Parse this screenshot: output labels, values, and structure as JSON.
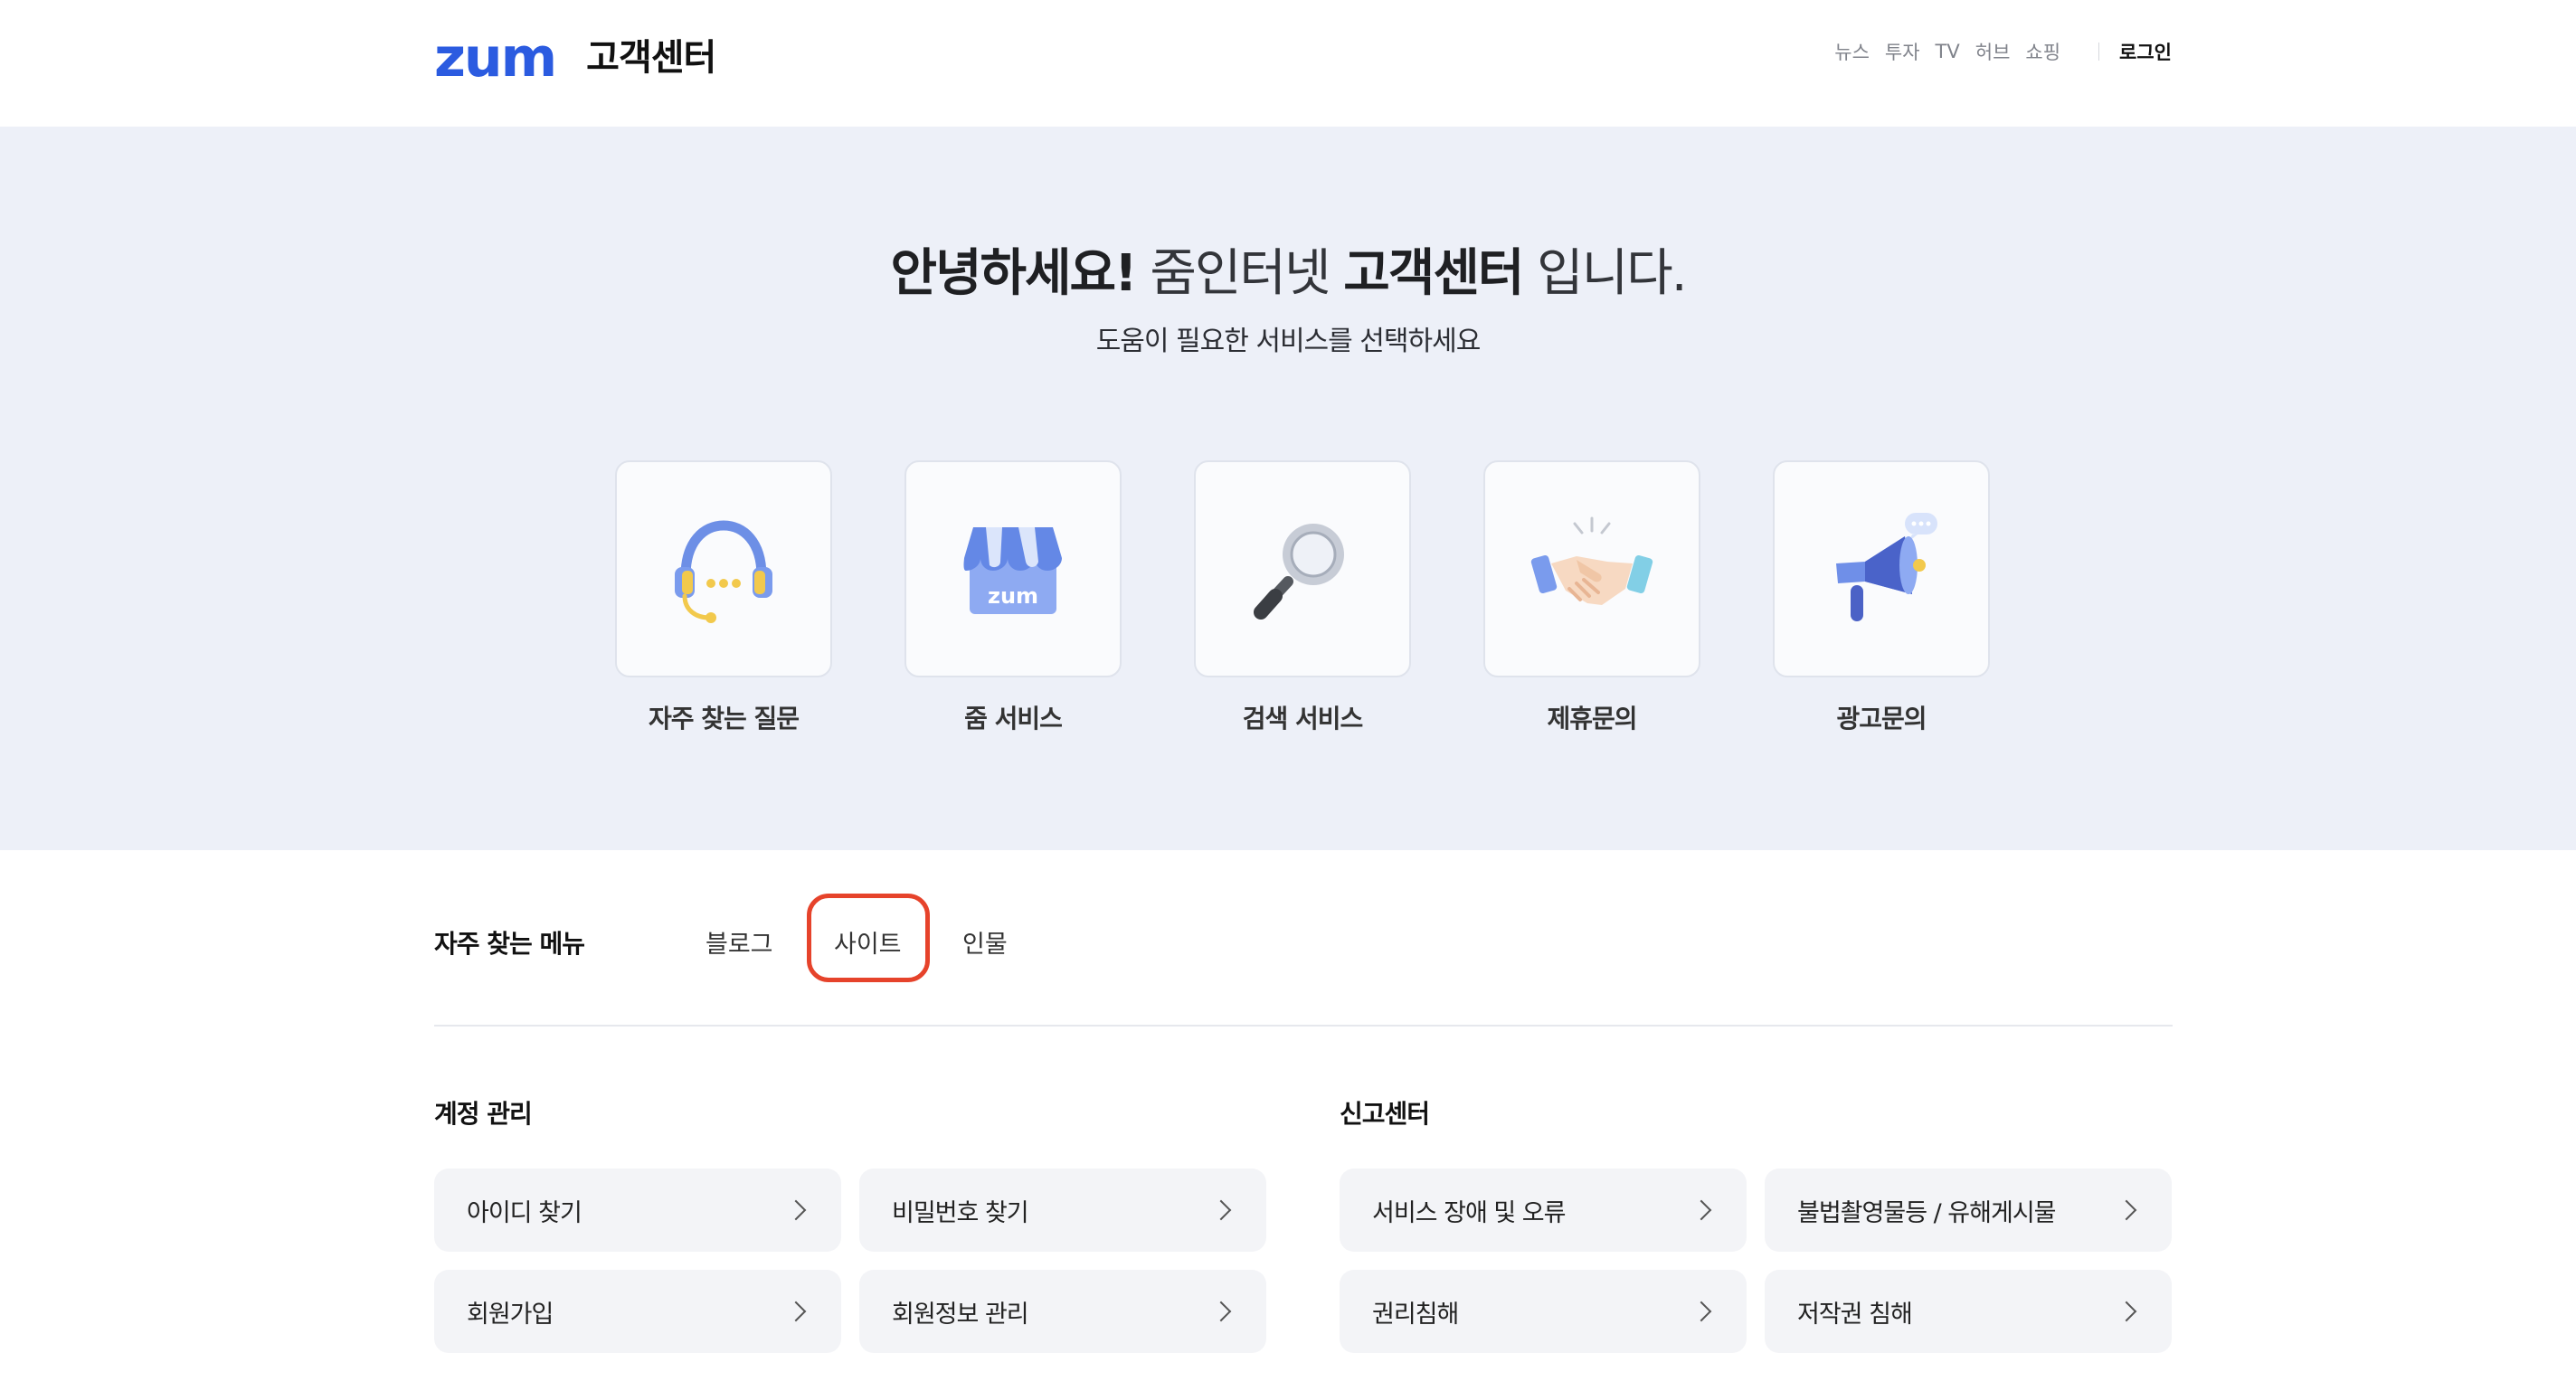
{
  "header": {
    "logo": "zum",
    "title": "고객센터",
    "nav": [
      "뉴스",
      "투자",
      "TV",
      "허브",
      "쇼핑"
    ],
    "login": "로그인"
  },
  "hero": {
    "title_greeting": "안녕하세요!",
    "title_brand": " 줌인터넷 ",
    "title_center": "고객센터",
    "title_end": " 입니다.",
    "subtitle": "도움이 필요한 서비스를 선택하세요",
    "cards": [
      {
        "label": "자주 찾는 질문",
        "icon": "headset-icon"
      },
      {
        "label": "줌 서비스",
        "icon": "store-icon"
      },
      {
        "label": "검색 서비스",
        "icon": "magnifier-icon"
      },
      {
        "label": "제휴문의",
        "icon": "handshake-icon"
      },
      {
        "label": "광고문의",
        "icon": "megaphone-icon"
      }
    ],
    "store_text": "zum"
  },
  "frequent_menu": {
    "title": "자주 찾는 메뉴",
    "tabs": [
      "블로그",
      "사이트",
      "인물"
    ]
  },
  "account": {
    "title": "계정 관리",
    "items": [
      "아이디 찾기",
      "비밀번호 찾기",
      "회원가입",
      "회원정보 관리"
    ]
  },
  "report": {
    "title": "신고센터",
    "items": [
      "서비스 장애 및 오류",
      "불법촬영물등 / 유해게시물",
      "권리침해",
      "저작권 침해"
    ]
  },
  "colors": {
    "brand": "#2b5be0",
    "hero_bg": "#edf0f8",
    "highlight": "#e6432b"
  }
}
